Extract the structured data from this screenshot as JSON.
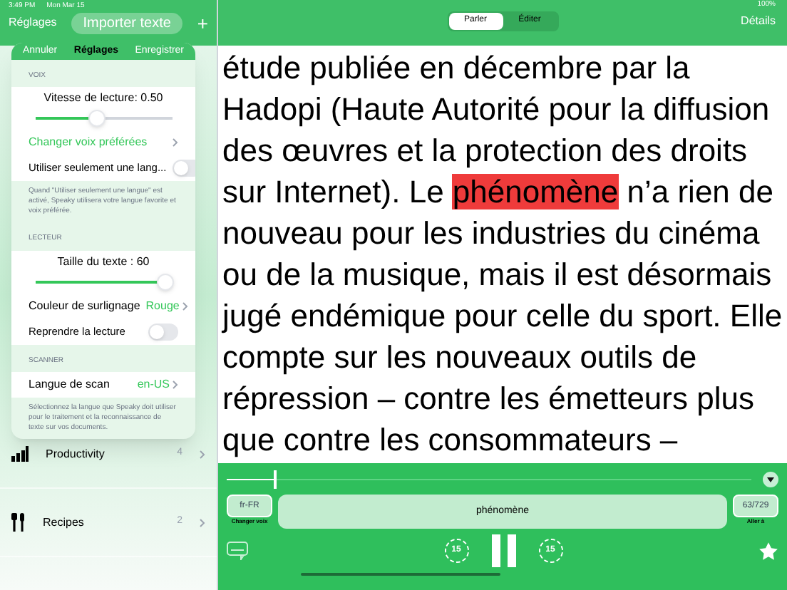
{
  "status_bar": {
    "time": "3:49 PM",
    "date": "Mon Mar 15",
    "battery": "100%"
  },
  "sidebar": {
    "back": "Réglages",
    "import_button": "Importer texte",
    "add": "+",
    "items": [
      {
        "label": "Productivity",
        "count": "4",
        "kind": "chart"
      },
      {
        "label": "Recipes",
        "count": "2",
        "kind": "cutlery"
      }
    ]
  },
  "popover": {
    "cancel": "Annuler",
    "title": "Réglages",
    "save": "Enregistrer",
    "sections": [
      {
        "header": "VOIX",
        "rows": [
          {
            "kind": "slider",
            "label": "Vitesse de lecture: 0.50",
            "level": 0.45
          },
          {
            "kind": "link",
            "label": "Changer voix préférées"
          },
          {
            "kind": "toggle",
            "label": "Utiliser seulement une lang...",
            "on": false
          }
        ],
        "footer": "Quand \"Utiliser seulement une langue\" est activé, Speaky utilisera votre langue favorite et voix préférée."
      },
      {
        "header": "LECTEUR",
        "rows": [
          {
            "kind": "slider",
            "label": "Taille du texte : 60",
            "level": 0.95
          },
          {
            "kind": "value",
            "label": "Couleur de surlignage",
            "value": "Rouge"
          },
          {
            "kind": "toggle",
            "label": "Reprendre la lecture",
            "on": false
          }
        ]
      },
      {
        "header": "SCANNER",
        "rows": [
          {
            "kind": "value",
            "label": "Langue de scan",
            "value": "en-US"
          }
        ],
        "footer": "Sélectionnez la langue que Speaky doit utiliser pour le traitement et la reconnaissance de texte sur vos documents."
      }
    ]
  },
  "header": {
    "tabs": [
      {
        "label": "Parler",
        "selected": true
      },
      {
        "label": "Éditer",
        "selected": false
      }
    ],
    "details": "Détails"
  },
  "reader": {
    "before": "étude publiée en décembre par la Hadopi (Haute Autorité pour la diffusion des œuvres et la protection des droits sur Internet).  Le ",
    "highlight": "phénomène",
    "after": " n’a rien de nouveau pour les industries du cinéma ou de la musique, mais il est désormais jugé endémique pour celle du sport. Elle compte sur les nouveaux outils de répression – contre les émetteurs plus que contre les consommateurs –"
  },
  "player": {
    "progress": {
      "level": 0.09
    },
    "voice": "fr-FR",
    "voice_caption": "Changer voix",
    "word": "phénomène",
    "position": "63/729",
    "position_caption": "Aller à",
    "back_seconds": "15",
    "forward_seconds": "15"
  }
}
